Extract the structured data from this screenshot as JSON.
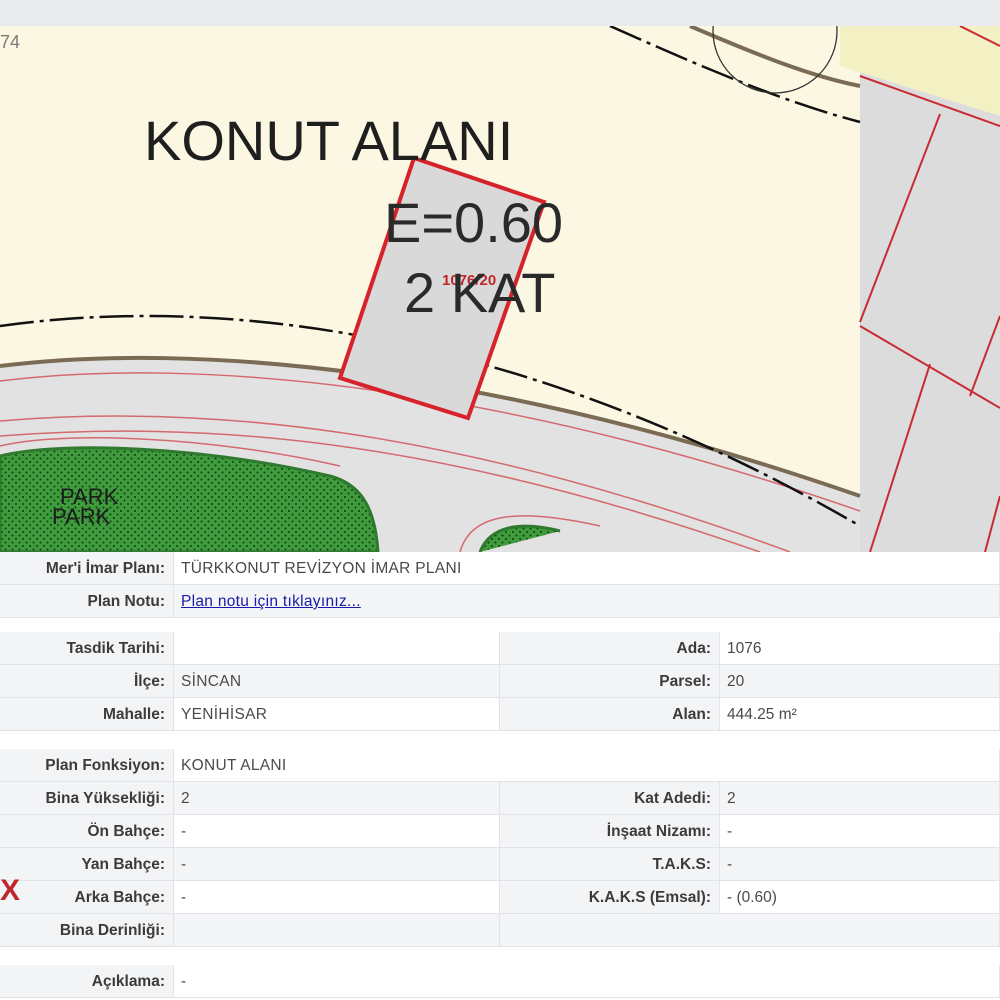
{
  "map": {
    "sheet_number": "74",
    "zone_title": "KONUT ALANI",
    "emsal": "E=0.60",
    "floors": "2 KAT",
    "parcel_label": "1076/20",
    "park_label_1": "PARK",
    "park_label_2": "PARK",
    "colors": {
      "residential_fill": "#fcf7e2",
      "parcel_border": "#d6222b",
      "road_fill": "#e3e3e3",
      "park_fill": "#3e9c3c"
    }
  },
  "info": {
    "general": [
      {
        "label": "Mer'i İmar Planı:",
        "value": "TÜRKKONUT REVİZYON İMAR PLANI"
      },
      {
        "label": "Plan Notu:",
        "value": "Plan notu için tıklayınız..."
      }
    ],
    "location_left": [
      {
        "label": "Tasdik Tarihi:",
        "value": ""
      },
      {
        "label": "İlçe:",
        "value": "SİNCAN"
      },
      {
        "label": "Mahalle:",
        "value": "YENİHİSAR"
      }
    ],
    "location_right": [
      {
        "label": "Ada:",
        "value": "1076"
      },
      {
        "label": "Parsel:",
        "value": "20"
      },
      {
        "label": "Alan:",
        "value": "444.25 m²"
      }
    ],
    "function": {
      "label": "Plan Fonksiyon:",
      "value": "KONUT ALANI"
    },
    "build_left": [
      {
        "label": "Bina Yüksekliği:",
        "value": "2"
      },
      {
        "label": "Ön Bahçe:",
        "value": "-"
      },
      {
        "label": "Yan Bahçe:",
        "value": "-"
      },
      {
        "label": "Arka Bahçe:",
        "value": "-"
      },
      {
        "label": "Bina Derinliği:",
        "value": ""
      }
    ],
    "build_right": [
      {
        "label": "Kat Adedi:",
        "value": "2"
      },
      {
        "label": "İnşaat Nizamı:",
        "value": "-"
      },
      {
        "label": "T.A.K.S:",
        "value": "-"
      },
      {
        "label": "K.A.K.S (Emsal):",
        "value": "- (0.60)"
      },
      {
        "label": "",
        "value": ""
      }
    ],
    "description": {
      "label": "Açıklama:",
      "value": "-"
    },
    "watermark_fragment": "X"
  }
}
